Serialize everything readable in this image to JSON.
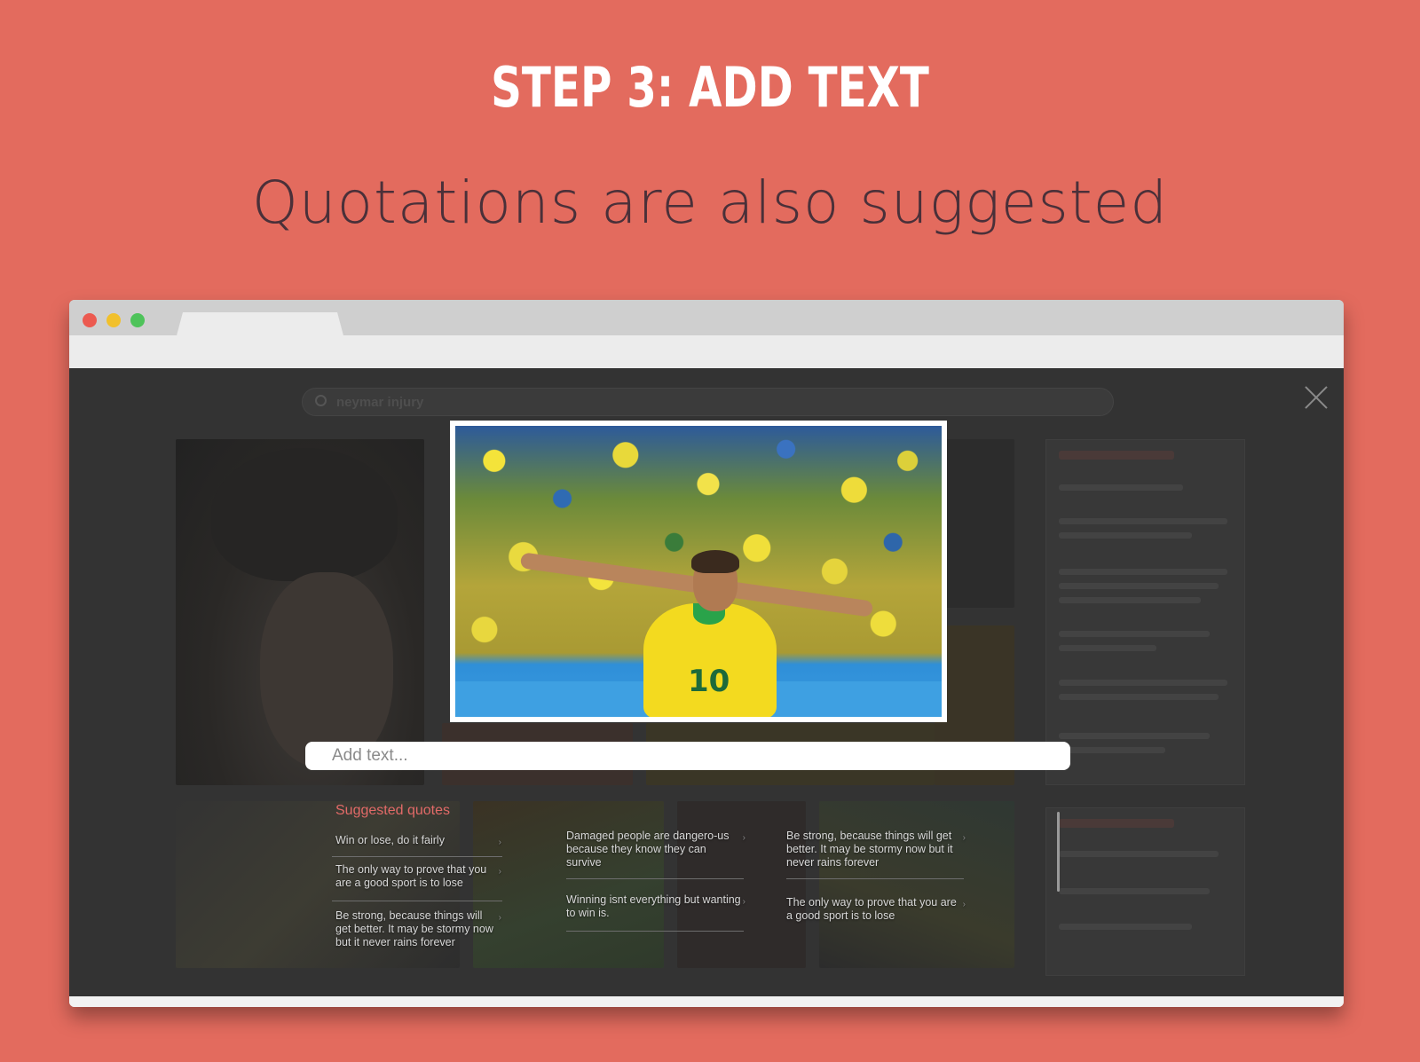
{
  "header": {
    "title": "STEP 3: ADD TEXT",
    "subtitle": "Quotations are also suggested"
  },
  "colors": {
    "background": "#e36b5e",
    "accent_quote_title": "#e26a68",
    "modal_overlay": "#333333"
  },
  "browser": {
    "window_controls": [
      "close-dot",
      "minimize-dot",
      "maximize-dot"
    ]
  },
  "app": {
    "search_query": "neymar injury"
  },
  "modal": {
    "add_text_placeholder": "Add text...",
    "suggested_quotes_title": "Suggested quotes",
    "quotes": [
      "Win or lose, do it fairly",
      "The only way to prove that you are a good sport is to lose",
      "Be strong, because things will get better. It may be stormy now but it never rains forever",
      "Damaged people are dangero-us because they know they can survive",
      "Winning isnt everything but wanting to win is.",
      "Be strong, because things will get better. It may be stormy now but it never rains forever",
      "The only way to prove that you are a good sport is to lose"
    ]
  }
}
